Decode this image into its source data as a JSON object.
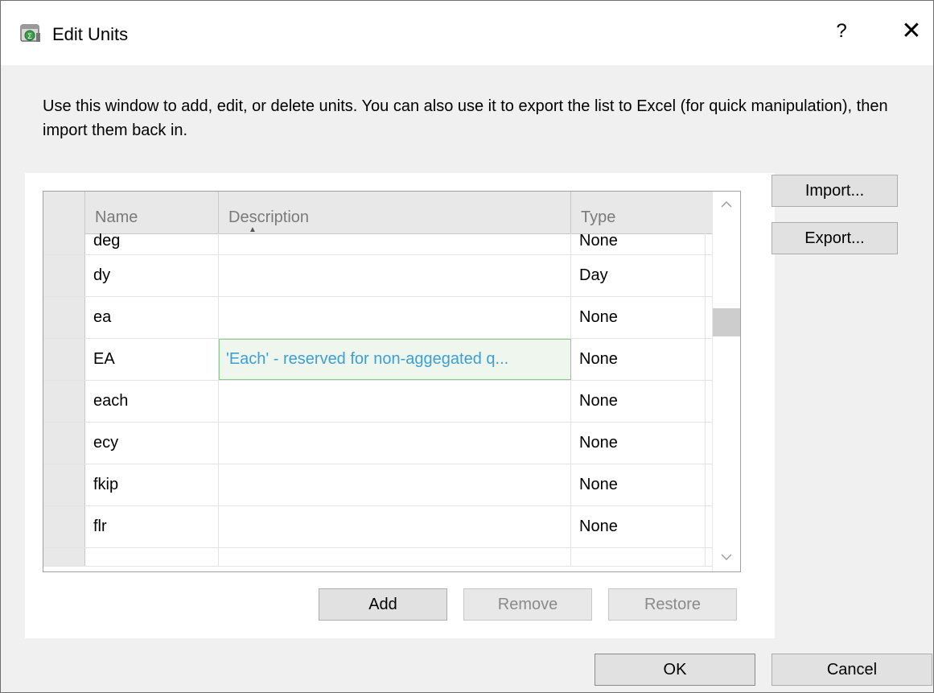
{
  "window": {
    "title": "Edit Units",
    "help_label": "?",
    "close_label": "✕"
  },
  "intro_text": "Use this window to add, edit, or delete units. You can also use it to export the list to Excel (for quick manipulation), then import them back in.",
  "grid": {
    "columns": [
      "Name",
      "Description",
      "Type"
    ],
    "sort_column": "Name",
    "sort_direction": "ascending",
    "rows": [
      {
        "name": "deg",
        "description": "",
        "type": "None"
      },
      {
        "name": "dy",
        "description": "",
        "type": "Day"
      },
      {
        "name": "ea",
        "description": "",
        "type": "None"
      },
      {
        "name": "EA",
        "description": "'Each' - reserved for non-aggegated q...",
        "type": "None"
      },
      {
        "name": "each",
        "description": "",
        "type": "None"
      },
      {
        "name": "ecy",
        "description": "",
        "type": "None"
      },
      {
        "name": "fkip",
        "description": "",
        "type": "None"
      },
      {
        "name": "flr",
        "description": "",
        "type": "None"
      }
    ]
  },
  "buttons": {
    "import": "Import...",
    "export": "Export...",
    "add": "Add",
    "remove": "Remove",
    "restore": "Restore",
    "ok": "OK",
    "cancel": "Cancel"
  },
  "colors": {
    "selected_text": "#3c9fd6",
    "selected_border": "#8ccb8c"
  },
  "icons": {
    "app": "units-dialog-icon",
    "sort": "sort-ascending-icon",
    "scroll_up": "chevron-up-icon",
    "scroll_down": "chevron-down-icon"
  }
}
